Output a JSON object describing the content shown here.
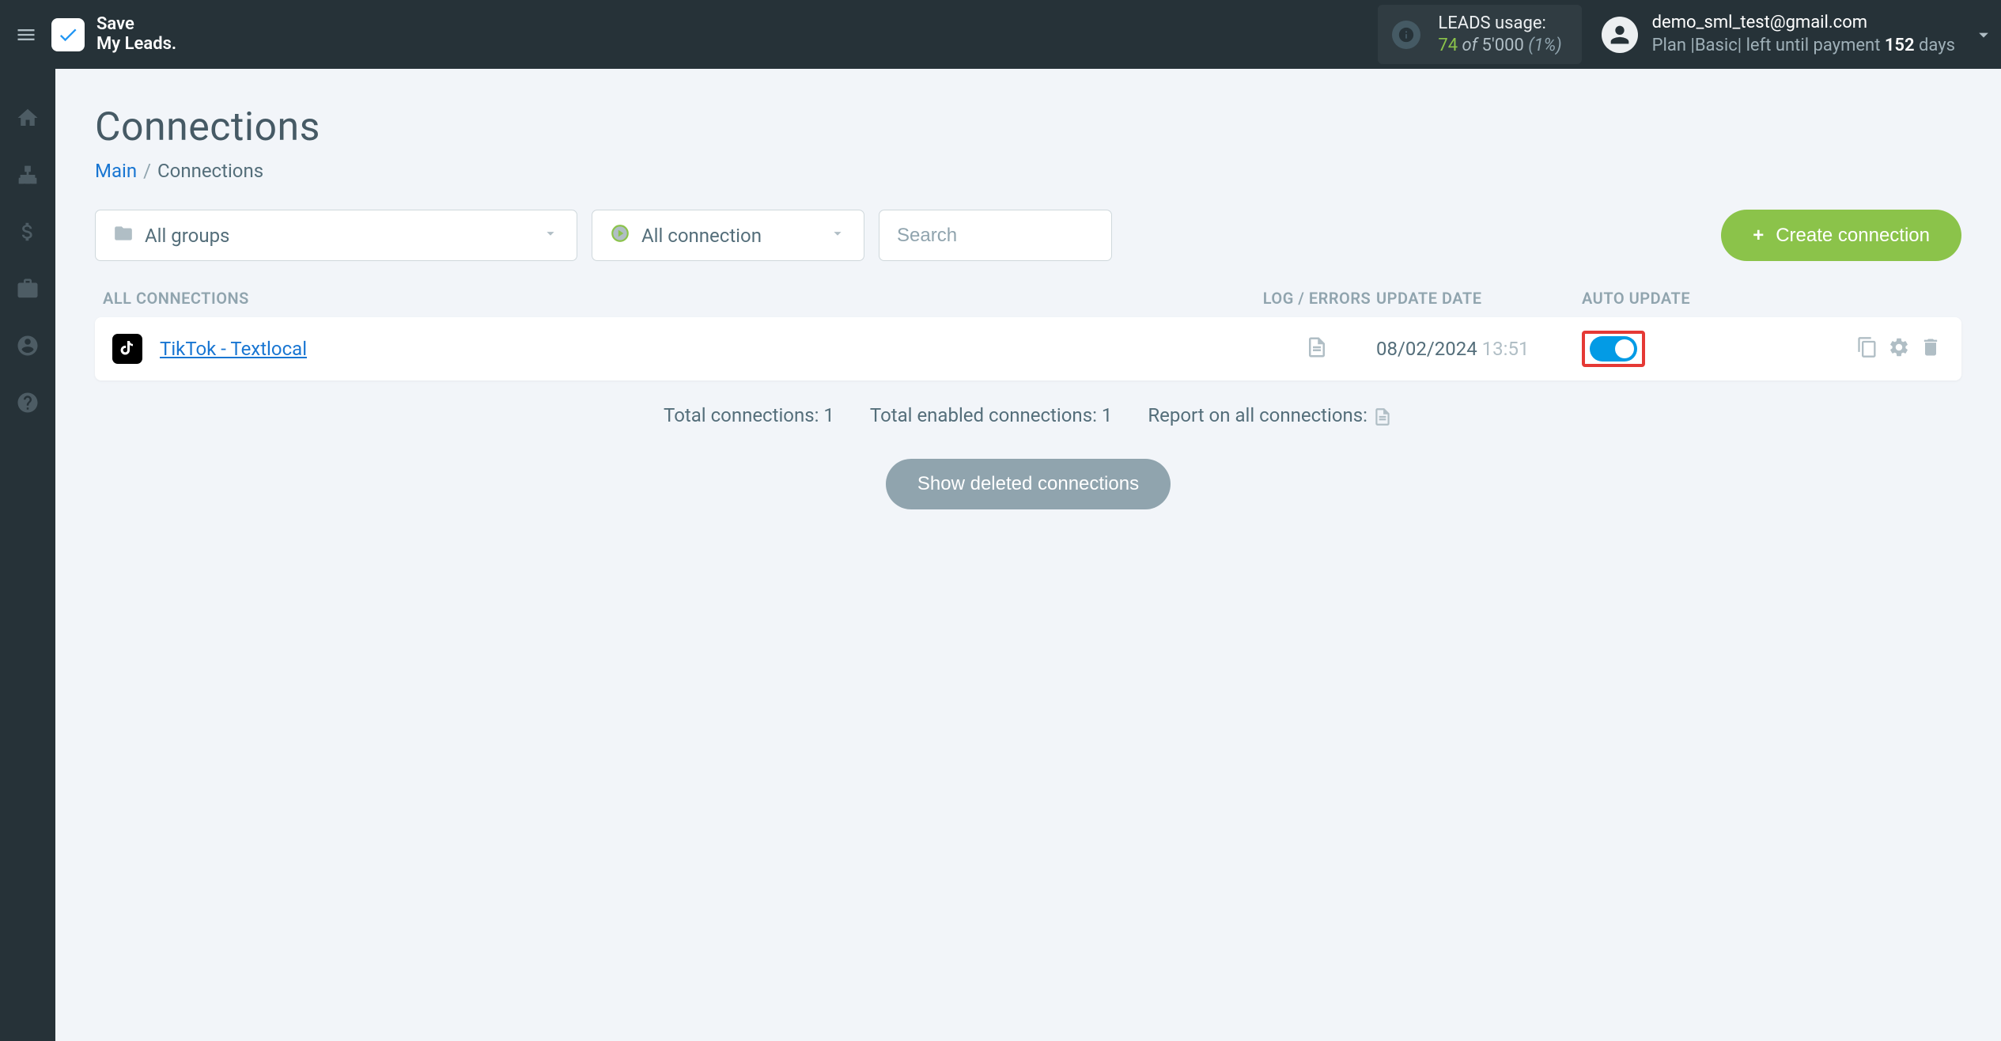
{
  "header": {
    "brand": {
      "line1": "Save",
      "line2": "My Leads."
    },
    "leads_usage": {
      "label": "LEADS usage:",
      "used": "74",
      "sep": " of ",
      "total": "5'000",
      "pct": "(1%)"
    },
    "account": {
      "email": "demo_sml_test@gmail.com",
      "plan_prefix": "Plan |",
      "plan_name": "Basic",
      "plan_suffix": "| left until payment ",
      "days": "152",
      "days_suffix": " days"
    }
  },
  "page": {
    "title": "Connections",
    "breadcrumb": {
      "main": "Main",
      "current": "Connections"
    }
  },
  "filters": {
    "groups": "All groups",
    "connection": "All connection",
    "search_placeholder": "Search"
  },
  "create_btn": "Create connection",
  "columns": {
    "name": "ALL CONNECTIONS",
    "log": "LOG / ERRORS",
    "date": "UPDATE DATE",
    "auto": "AUTO UPDATE"
  },
  "connections": [
    {
      "name": "TikTok - Textlocal",
      "date": "08/02/2024",
      "time": "13:51",
      "auto_update": true
    }
  ],
  "summary": {
    "total_label": "Total connections: ",
    "total_value": "1",
    "enabled_label": "Total enabled connections: ",
    "enabled_value": "1",
    "report_label": "Report on all connections: "
  },
  "show_deleted": "Show deleted connections"
}
